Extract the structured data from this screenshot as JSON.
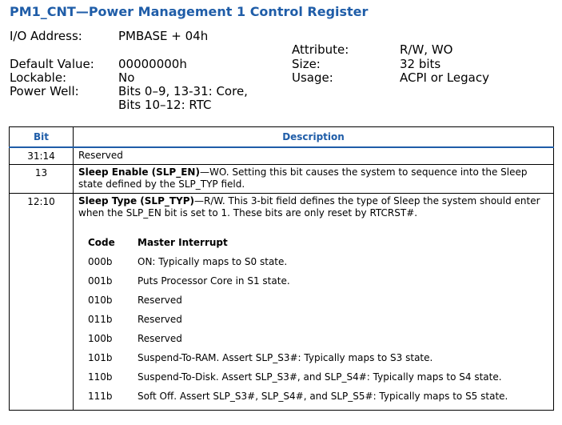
{
  "title": "PM1_CNT—Power Management 1 Control Register",
  "register_info": {
    "io_address_label": "I/O Address:",
    "io_address_value": "PMBASE + 04h",
    "default_value_label": "Default Value:",
    "default_value_value": "00000000h",
    "lockable_label": "Lockable:",
    "lockable_value": "No",
    "power_well_label": "Power Well:",
    "power_well_value_line1": "Bits 0–9, 13-31: Core,",
    "power_well_value_line2": "Bits 10–12: RTC",
    "attribute_label": "Attribute:",
    "attribute_value": "R/W, WO",
    "size_label": "Size:",
    "size_value": "32 bits",
    "usage_label": "Usage:",
    "usage_value": "ACPI or Legacy"
  },
  "table": {
    "headers": {
      "bit": "Bit",
      "description": "Description"
    },
    "rows": [
      {
        "bit": "31:14",
        "desc_bold": "",
        "desc_text": "Reserved"
      },
      {
        "bit": "13",
        "desc_bold": "Sleep Enable (SLP_EN)",
        "desc_text": "—WO. Setting this bit causes the system to sequence into the Sleep state defined by the SLP_TYP field."
      },
      {
        "bit": "12:10",
        "desc_bold": "Sleep Type (SLP_TYP)",
        "desc_text": "—R/W. This 3-bit field defines the type of Sleep the system should enter when the SLP_EN bit is set to 1. These bits are only reset by RTCRST#."
      }
    ],
    "code_table": {
      "headers": {
        "code": "Code",
        "master_interrupt": "Master Interrupt"
      },
      "rows": [
        {
          "code": "000b",
          "description": "ON: Typically maps to S0 state."
        },
        {
          "code": "001b",
          "description": "Puts Processor Core in S1 state."
        },
        {
          "code": "010b",
          "description": "Reserved"
        },
        {
          "code": "011b",
          "description": "Reserved"
        },
        {
          "code": "100b",
          "description": "Reserved"
        },
        {
          "code": "101b",
          "description": "Suspend-To-RAM. Assert SLP_S3#: Typically maps to S3 state."
        },
        {
          "code": "110b",
          "description": "Suspend-To-Disk. Assert SLP_S3#, and SLP_S4#: Typically maps to S4 state."
        },
        {
          "code": "111b",
          "description": "Soft Off. Assert SLP_S3#, SLP_S4#, and SLP_S5#: Typically maps to S5 state."
        }
      ]
    }
  }
}
